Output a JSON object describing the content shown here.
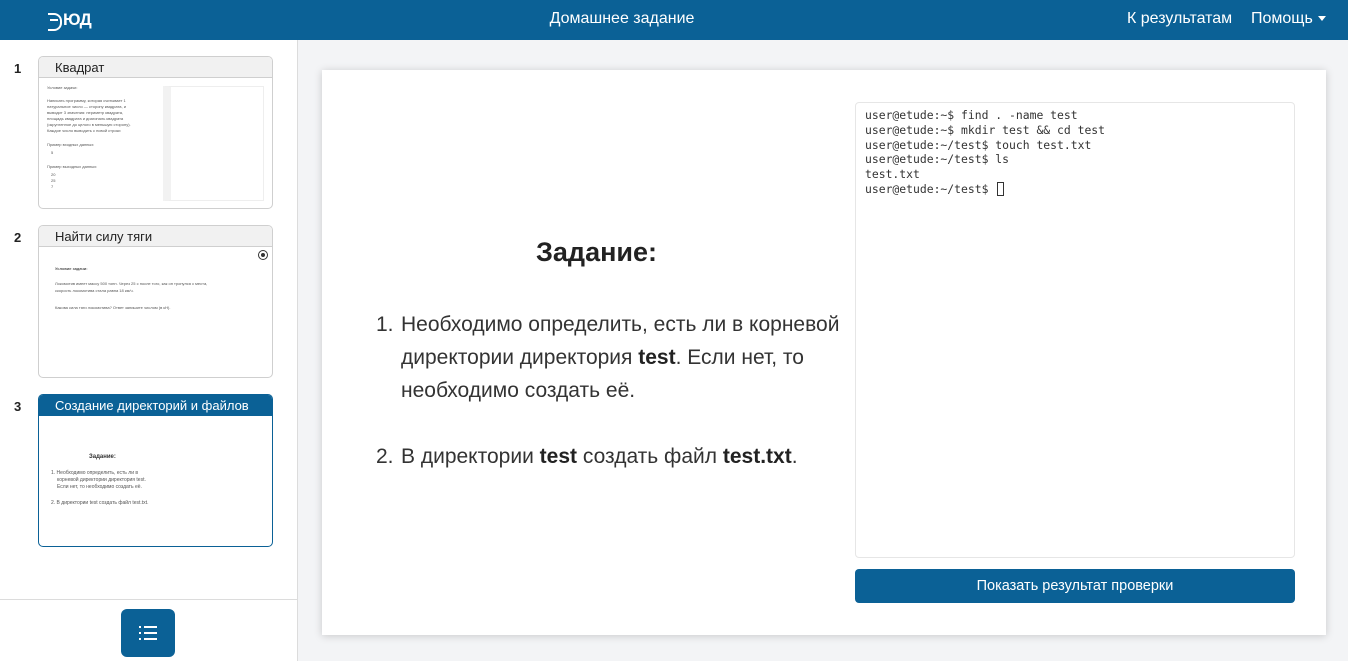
{
  "header": {
    "logo_text": "ЮД",
    "title": "Домашнее задание",
    "results_link": "К результатам",
    "help_menu": "Помощь",
    "bg_color": "#0b6196"
  },
  "sidebar": {
    "tasks": [
      {
        "number": "1",
        "title": "Квадрат",
        "preview": [
          "Условие задачи:",
          "Написать программу, которая считывает 1",
          "натуральное число — сторону квадрата, и",
          "выводит 3 значения: периметр квадрата,",
          "площадь квадрата и диагональ квадрата",
          "(округленное до целого в меньшую сторону).",
          "Каждое число выводить с новой строки",
          "Пример входных данных:",
          "5",
          "Пример выходных данных:",
          "20",
          "25",
          "7"
        ]
      },
      {
        "number": "2",
        "title": "Найти силу тяги",
        "preview": [
          "Условие задачи:",
          "Локомотив имеет массу 500 тонн. Через 25 с после того, как он тронулся с места,",
          "скорость локомотива стала равна 18 км/ч.",
          "Какова сила тяги локомотива? Ответ запишите числом (в кН)."
        ]
      },
      {
        "number": "3",
        "title": "Создание директорий и файлов",
        "preview": [
          "Задание:",
          "1. Необходимо определить, есть ли в",
          "корневой директории директория test.",
          "Если нет, то необходимо создать её.",
          "2. В директории test создать файл test.txt."
        ]
      }
    ],
    "list_button_icon": "list-icon"
  },
  "task": {
    "heading": "Задание:",
    "item1": {
      "number": "1.",
      "part1": "Необходимо определить, есть ли в корневой директории директория ",
      "bold": "test",
      "part2": ". Если нет, то необходимо создать её."
    },
    "item2": {
      "number": "2.",
      "part1": "В директории ",
      "bold1": "test",
      "part2": " создать файл ",
      "bold2": "test.txt",
      "part3": "."
    }
  },
  "terminal": {
    "lines": [
      "user@etude:~$ find . -name test",
      "user@etude:~$ mkdir test && cd test",
      "user@etude:~/test$ touch test.txt",
      "user@etude:~/test$ ls",
      "test.txt"
    ],
    "prompt": "user@etude:~/test$ "
  },
  "check_button": "Показать результат проверки"
}
